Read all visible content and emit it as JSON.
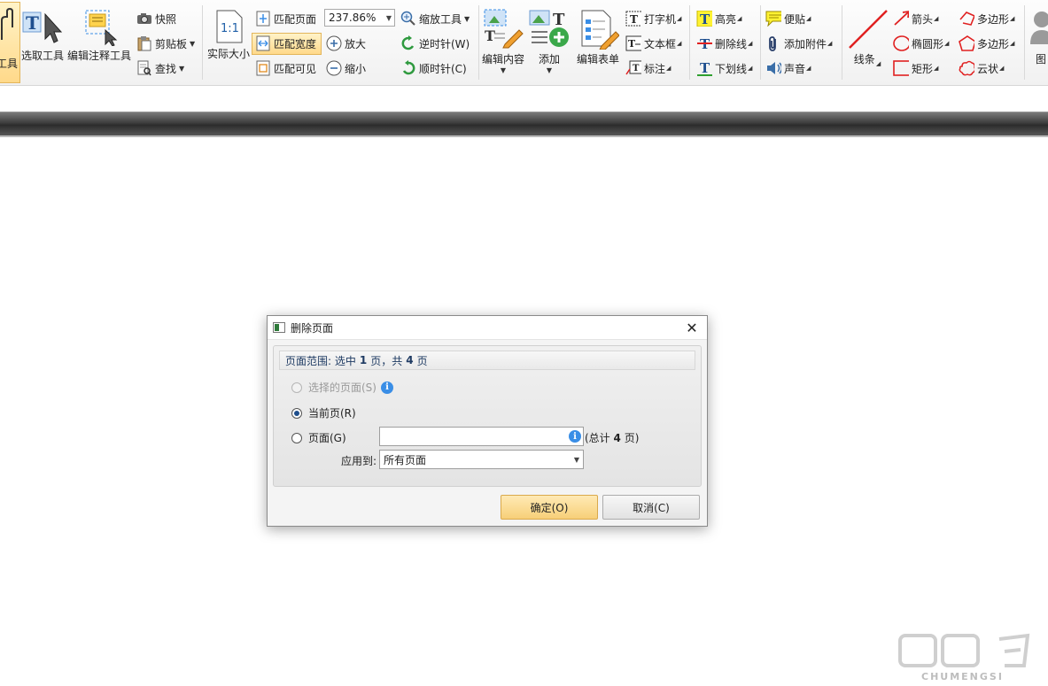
{
  "toolbar": {
    "hand_tool": "工具",
    "select_tool": "选取工具",
    "edit_annotation_tool": "编辑注释工具",
    "snapshot": "快照",
    "clipboard": "剪贴板",
    "find": "查找",
    "actual_size": "实际大小",
    "fit_page": "匹配页面",
    "fit_width": "匹配宽度",
    "fit_visible": "匹配可见",
    "zoom_value": "237.86%",
    "zoom_tool": "缩放工具",
    "zoom_in": "放大",
    "zoom_out": "缩小",
    "rotate_ccw": "逆时针(W)",
    "rotate_cw": "顺时针(C)",
    "edit_content": "编辑内容",
    "add": "添加",
    "edit_form": "编辑表单",
    "typewriter": "打字机",
    "textbox": "文本框",
    "callout": "标注",
    "highlight": "高亮",
    "strikeout": "删除线",
    "underline": "下划线",
    "sticky_note": "便贴",
    "attach_file": "添加附件",
    "sound": "声音",
    "line": "线条",
    "arrow": "箭头",
    "ellipse": "椭圆形",
    "rectangle": "矩形",
    "polygon1": "多边形",
    "polygon2": "多边形",
    "cloud": "云状",
    "image_partial": "图"
  },
  "dialog": {
    "title": "删除页面",
    "range_prefix": "页面范围: 选中",
    "range_selected": "1",
    "range_mid": "页，共",
    "range_total": "4",
    "range_suffix": "页",
    "opt_selected": "选择的页面(S)",
    "opt_current": "当前页(R)",
    "opt_pages": "页面(G)",
    "pages_value": "",
    "total_prefix": "(总计",
    "total_count": "4",
    "total_suffix": "页)",
    "apply_label": "应用到:",
    "apply_value": "所有页面",
    "ok": "确定(O)",
    "cancel": "取消(C)"
  },
  "watermark": {
    "text": "CHUMENGSI"
  },
  "colors": {
    "active_yellow": "#ffd98a",
    "dialog_bg": "#f4f4f4",
    "info_blue": "#3a8ee6",
    "ribbon_red": "#e02020"
  }
}
